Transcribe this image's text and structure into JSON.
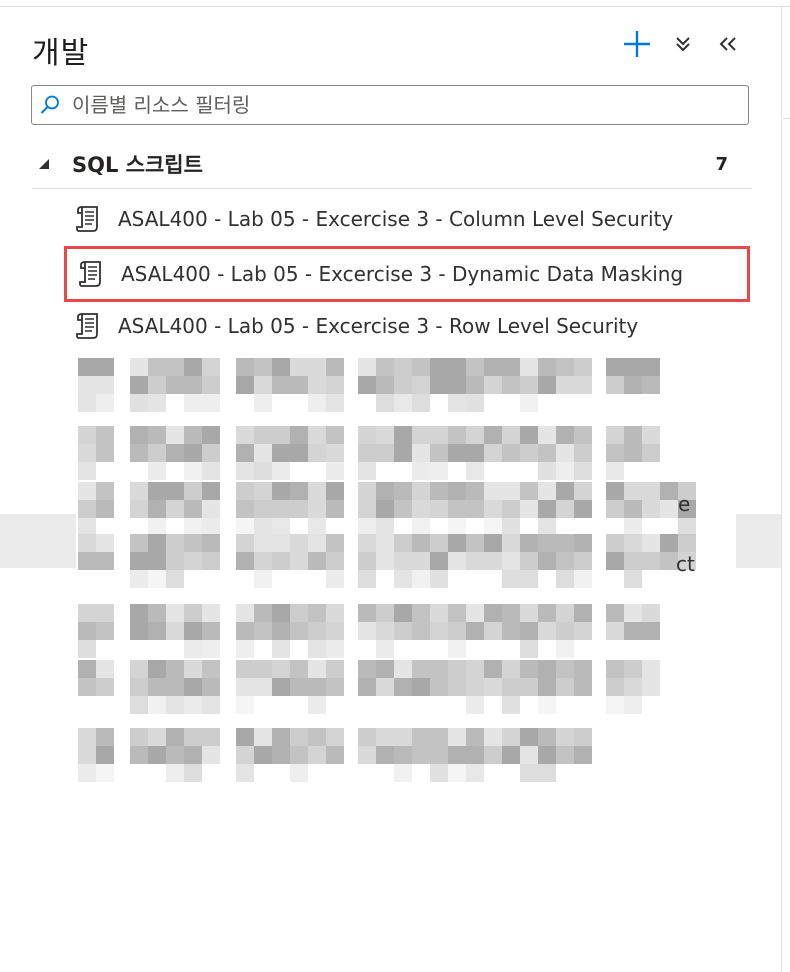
{
  "panel": {
    "title": "개발",
    "search": {
      "placeholder": "이름별 리소스 필터링",
      "value": ""
    },
    "group": {
      "label": "SQL 스크립트",
      "count": "7",
      "items": [
        {
          "name": "ASAL400 - Lab 05 - Excercise 3 - Column Level Security",
          "selected": false
        },
        {
          "name": "ASAL400 - Lab 05 - Excercise 3 - Dynamic Data Masking",
          "selected": true
        },
        {
          "name": "ASAL400 - Lab 05 - Excercise 3 - Row Level Security",
          "selected": false
        }
      ],
      "obscured_fragments": [
        "e",
        "ct"
      ]
    }
  },
  "colors": {
    "accent": "#0078d4",
    "selection_border": "#e5484d",
    "text": "#323130",
    "divider": "#e1e1e1"
  },
  "icons": {
    "add": "plus-icon",
    "collapse_all": "double-chevron-down-icon",
    "collapse_panel": "double-chevron-left-icon",
    "search": "search-icon",
    "group_caret": "caret-down-icon",
    "script": "sql-script-icon"
  }
}
